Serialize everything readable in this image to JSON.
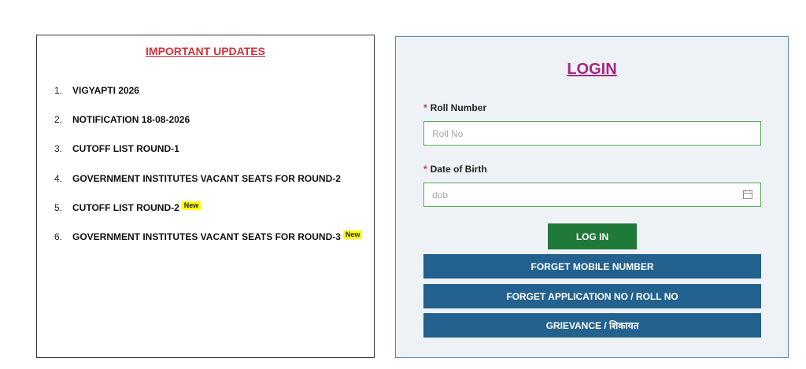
{
  "updates": {
    "title": "IMPORTANT UPDATES",
    "new_label": "New",
    "items": [
      {
        "num": "1.",
        "label": "VIGYAPTI 2026",
        "is_new": false
      },
      {
        "num": "2.",
        "label": "NOTIFICATION 18-08-2026",
        "is_new": false
      },
      {
        "num": "3.",
        "label": "CUTOFF LIST ROUND-1",
        "is_new": false
      },
      {
        "num": "4.",
        "label": "GOVERNMENT INSTITUTES VACANT SEATS FOR ROUND-2",
        "is_new": false
      },
      {
        "num": "5.",
        "label": "CUTOFF LIST ROUND-2",
        "is_new": true
      },
      {
        "num": "6.",
        "label": "GOVERNMENT INSTITUTES VACANT SEATS FOR ROUND-3",
        "is_new": true
      }
    ]
  },
  "login": {
    "title": "LOGIN",
    "required_mark": "*",
    "roll_label": "Roll Number",
    "roll_placeholder": "Roll No",
    "roll_value": "",
    "dob_label": "Date of Birth",
    "dob_placeholder": "dob",
    "dob_value": "",
    "login_button": "LOG IN",
    "forget_mobile": "FORGET MOBILE NUMBER",
    "forget_application": "FORGET APPLICATION NO / ROLL NO",
    "grievance": "GRIEVANCE / शिकायत",
    "calendar_icon": "calendar-icon"
  },
  "colors": {
    "updates_title": "#d0343b",
    "login_title": "#a3287f",
    "login_button": "#1f7a3a",
    "action_buttons": "#23618f",
    "new_badge": "#ffff00"
  }
}
